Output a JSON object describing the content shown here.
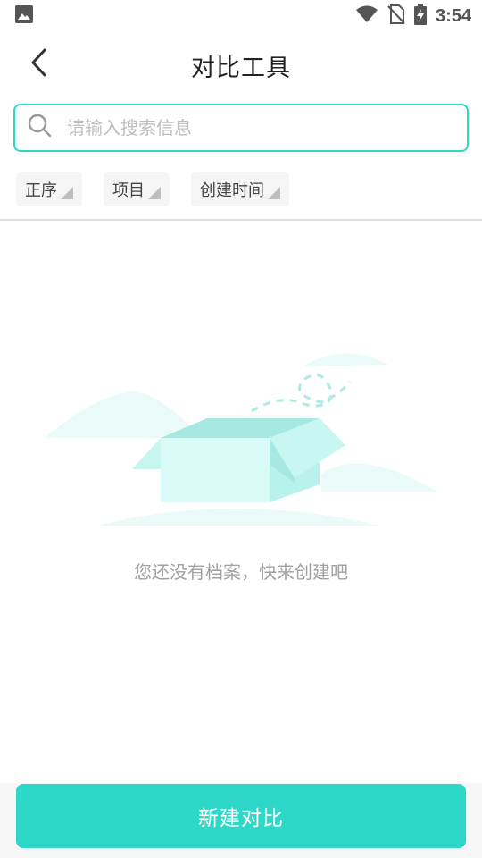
{
  "status_bar": {
    "time": "3:54",
    "icons": [
      "image-icon",
      "wifi-icon",
      "no-sim-icon",
      "battery-charging-icon"
    ]
  },
  "header": {
    "back_icon": "chevron-left-icon",
    "title": "对比工具"
  },
  "search": {
    "icon": "search-icon",
    "placeholder": "请输入搜索信息",
    "value": ""
  },
  "filters": [
    {
      "label": "正序"
    },
    {
      "label": "项目"
    },
    {
      "label": "创建时间"
    }
  ],
  "empty_state": {
    "illustration": "empty-box-illustration",
    "message": "您还没有档案，快来创建吧"
  },
  "create_button": {
    "label": "新建对比"
  },
  "colors": {
    "accent": "#2ed8c8",
    "box_light": "#d8fbf8",
    "box_mid": "#b9f1ec",
    "box_dark": "#a6e8e2",
    "hill": "#eafaf8"
  }
}
